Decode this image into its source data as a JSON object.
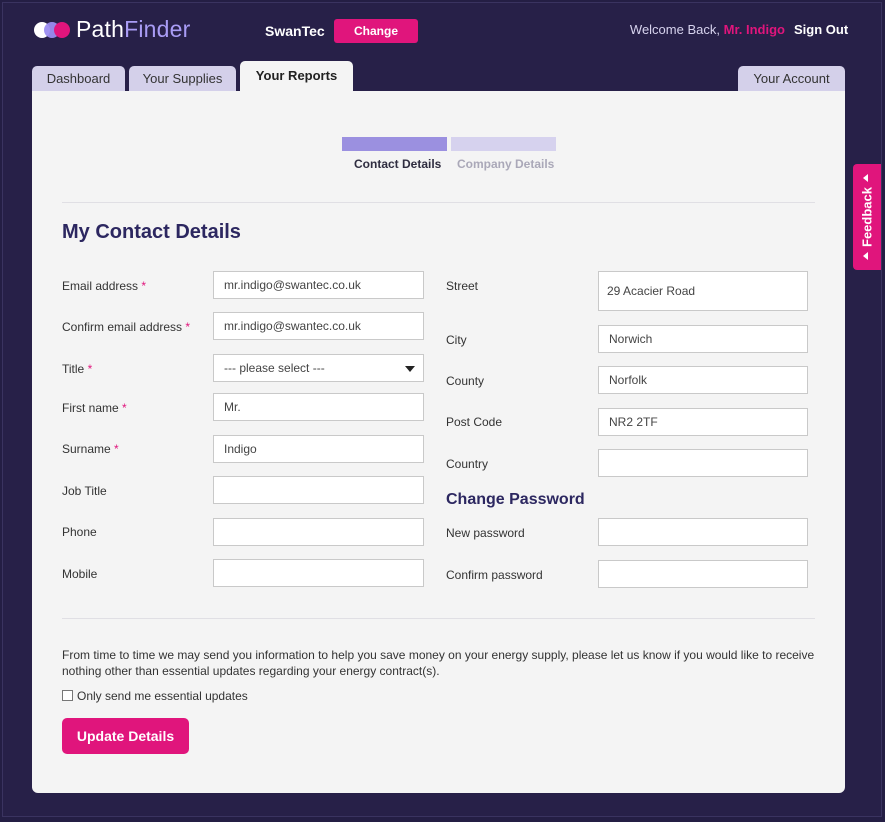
{
  "header": {
    "logo_path": "Path",
    "logo_finder": "Finder",
    "company": "SwanTec",
    "change_label": "Change",
    "welcome_prefix": "Welcome Back,",
    "user_name": "Mr. Indigo",
    "sign_out": "Sign Out"
  },
  "tabs": [
    {
      "label": "Dashboard",
      "active": false
    },
    {
      "label": "Your Supplies",
      "active": false
    },
    {
      "label": "Your Reports",
      "active": true
    },
    {
      "label": "Your Account",
      "active": false
    }
  ],
  "steps": [
    {
      "label": "Contact Details",
      "active": true
    },
    {
      "label": "Company Details",
      "active": false
    }
  ],
  "form": {
    "heading": "My Contact Details",
    "left_fields": [
      {
        "label": "Email address",
        "required": true,
        "value": "mr.indigo@swantec.co.uk"
      },
      {
        "label": "Confirm email address",
        "required": true,
        "value": "mr.indigo@swantec.co.uk"
      },
      {
        "label": "Title",
        "required": true,
        "value": "--- please select ---"
      },
      {
        "label": "First name",
        "required": true,
        "value": "Mr."
      },
      {
        "label": "Surname",
        "required": true,
        "value": "Indigo"
      },
      {
        "label": "Job Title",
        "required": false,
        "value": ""
      },
      {
        "label": "Phone",
        "required": false,
        "value": ""
      },
      {
        "label": "Mobile",
        "required": false,
        "value": ""
      }
    ],
    "right_fields": [
      {
        "label": "Street",
        "value": "29 Acacier Road"
      },
      {
        "label": "City",
        "value": "Norwich"
      },
      {
        "label": "County",
        "value": "Norfolk"
      },
      {
        "label": "Post Code",
        "value": "NR2 2TF"
      },
      {
        "label": "Country",
        "value": ""
      }
    ],
    "password_heading": "Change Password",
    "password_fields": [
      {
        "label": "New password",
        "value": ""
      },
      {
        "label": "Confirm password",
        "value": ""
      }
    ],
    "required_marker": "*",
    "info_text": "From time to time we may send you information to help you save money on your energy supply, please let us know if you would like to receive nothing other than essential updates regarding your energy contract(s).",
    "checkbox_label": "Only send me essential updates",
    "checkbox_checked": false,
    "submit_label": "Update Details"
  },
  "feedback_label": "Feedback",
  "colors": {
    "background": "#241e44",
    "accent": "#e0157c",
    "step_active": "#9b90e0",
    "step_inactive": "#d6d2ee",
    "heading": "#2c2760"
  },
  "icons": {
    "logo": "logo-circles-icon",
    "select": "dropdown-arrow-icon",
    "feedback": "triangle-left-icon"
  }
}
